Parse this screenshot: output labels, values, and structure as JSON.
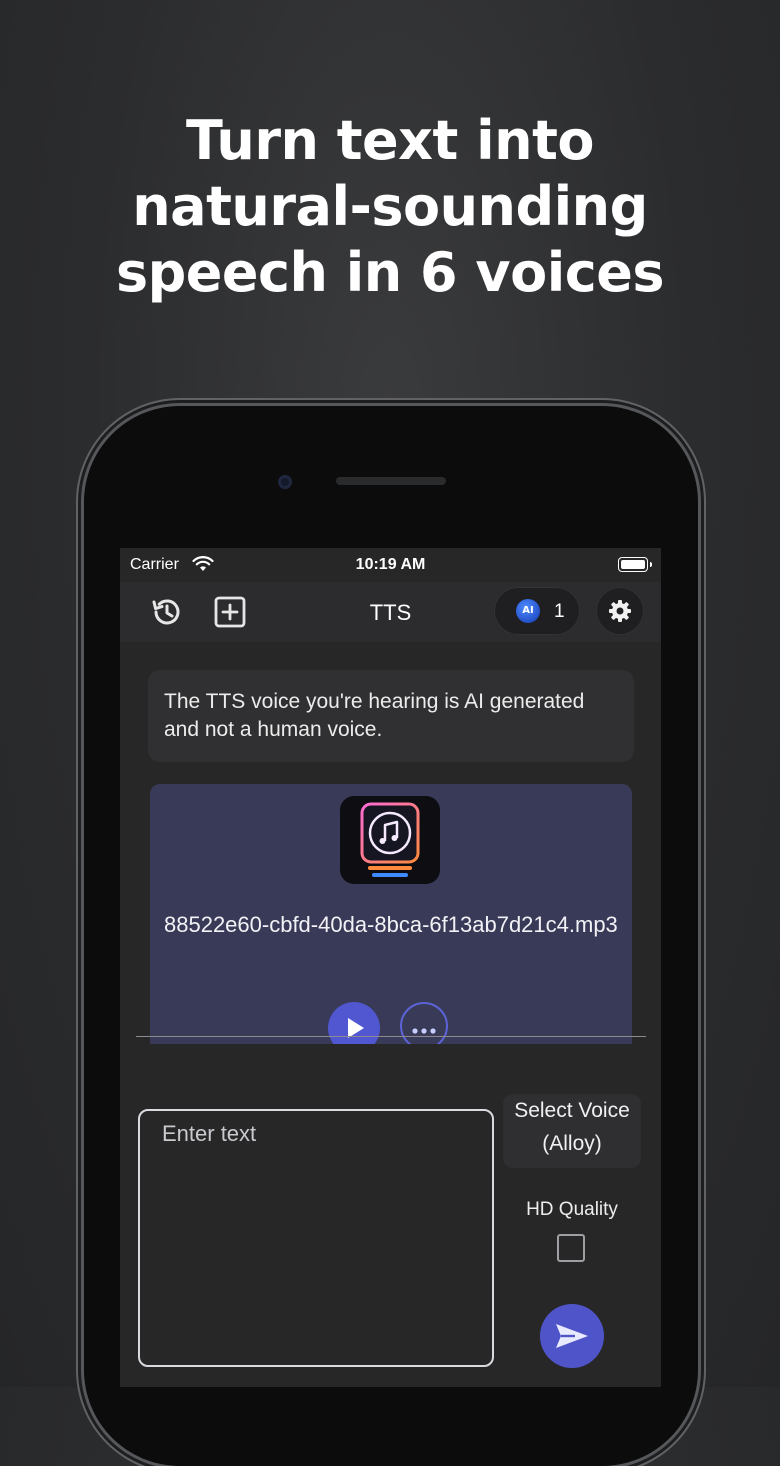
{
  "headline": {
    "line1": "Turn text into",
    "line2": "natural-sounding",
    "line3": "speech in 6 voices"
  },
  "status_bar": {
    "carrier": "Carrier",
    "time": "10:19 AM"
  },
  "navbar": {
    "title": "TTS",
    "credits_badge": "AI",
    "credits_count": "1",
    "icons": [
      "history-icon",
      "add-square-icon",
      "ai-credit-icon",
      "gear-icon"
    ]
  },
  "disclaimer": {
    "text": "The TTS voice you're hearing is AI generated and not a human voice."
  },
  "audio_card": {
    "filename": "88522e60-cbfd-40da-8bca-6f13ab7d21c4.mp3",
    "icons": [
      "music-note-icon",
      "play-icon",
      "more-icon"
    ]
  },
  "composer": {
    "text_placeholder": "Enter text",
    "voice_button_line1": "Select Voice",
    "voice_button_line2": "(Alloy)",
    "hd_label": "HD Quality",
    "hd_checked": false
  },
  "colors": {
    "background": "#2b2c2e",
    "screen": "#272728",
    "card": "#393a57",
    "accent": "#4f55c9"
  }
}
